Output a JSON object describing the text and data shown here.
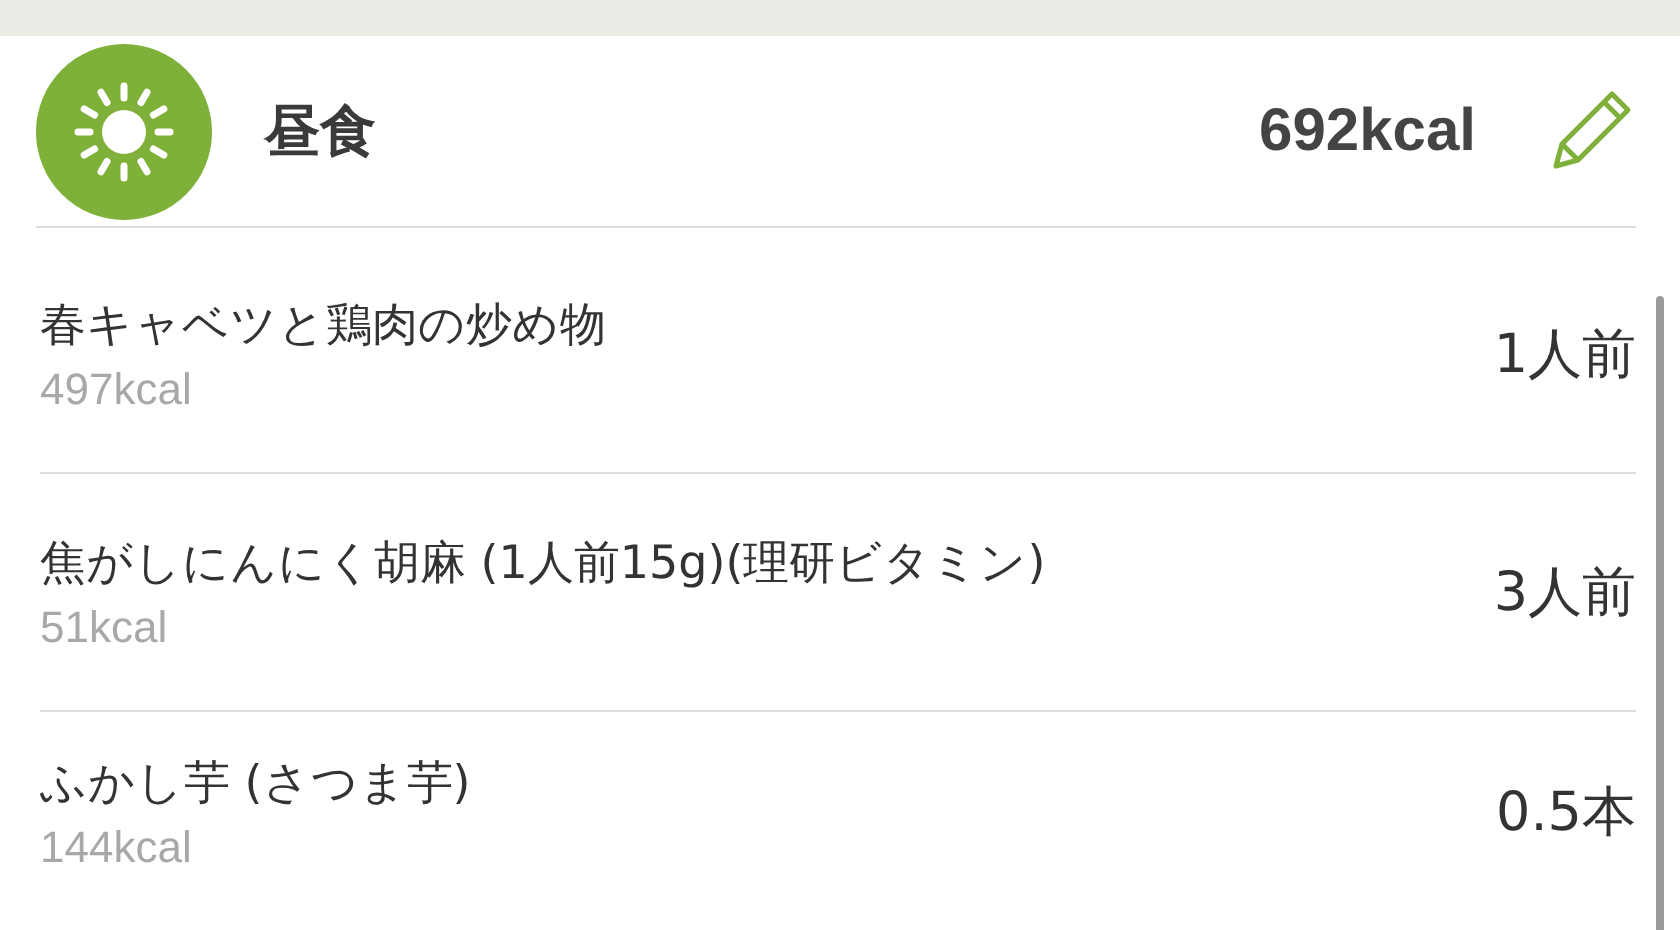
{
  "meal": {
    "title": "昼食",
    "total": "692kcal"
  },
  "items": [
    {
      "name": "春キャベツと鶏肉の炒め物",
      "kcal": "497kcal",
      "amount": "1人前"
    },
    {
      "name": "焦がしにんにく胡麻 (1人前15g)(理研ビタミン)",
      "kcal": "51kcal",
      "amount": "3人前"
    },
    {
      "name": "ふかし芋 (さつま芋)",
      "kcal": "144kcal",
      "amount": "0.5本"
    }
  ]
}
